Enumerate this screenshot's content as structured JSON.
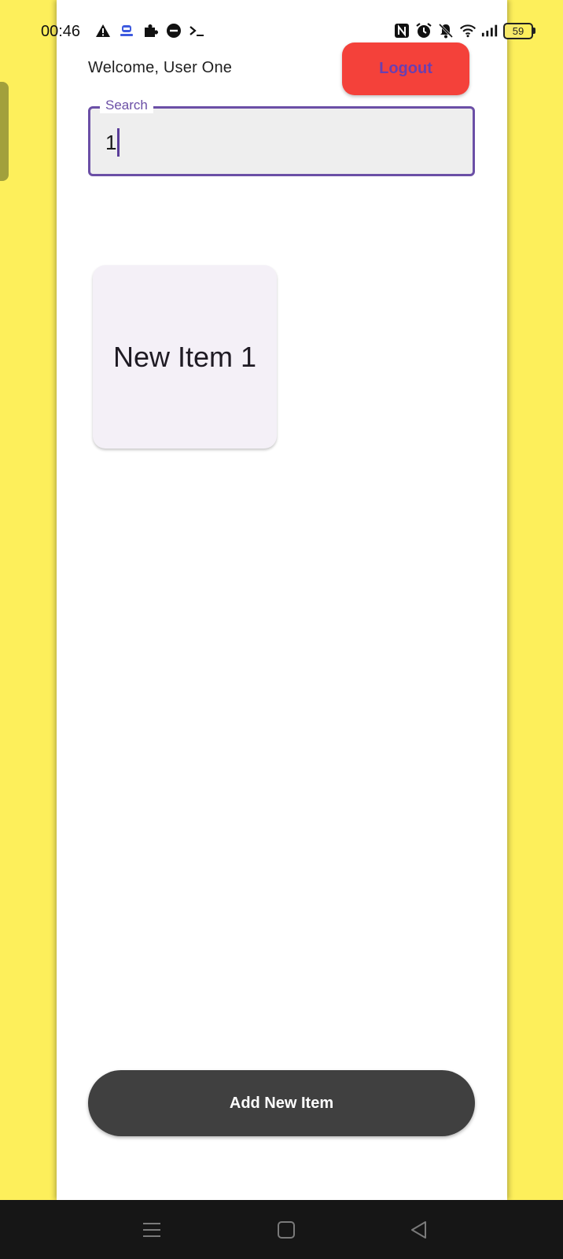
{
  "status_bar": {
    "time": "00:46",
    "battery_level": "59",
    "left_icons": [
      "warning-icon",
      "vpn-robot-icon",
      "puzzle-icon",
      "do-not-disturb-icon",
      "terminal-icon"
    ],
    "right_icons": [
      "nfc-icon",
      "alarm-icon",
      "bell-off-icon",
      "wifi-icon",
      "signal-icon",
      "battery-icon"
    ]
  },
  "header": {
    "welcome_text": "Welcome, User One",
    "logout_label": "Logout"
  },
  "search": {
    "label": "Search",
    "value": "1"
  },
  "items": [
    {
      "title": "New Item 1"
    }
  ],
  "actions": {
    "add_label": "Add New Item"
  },
  "nav_bar": {
    "buttons": [
      "menu-icon",
      "home-icon",
      "back-icon"
    ]
  },
  "colors": {
    "background_yellow": "#fdef5b",
    "logout_button": "#f4413a",
    "logout_text": "#6a3fb0",
    "search_border": "#6b4fa6",
    "add_button": "#404040",
    "card_background": "#f4f0f7"
  }
}
